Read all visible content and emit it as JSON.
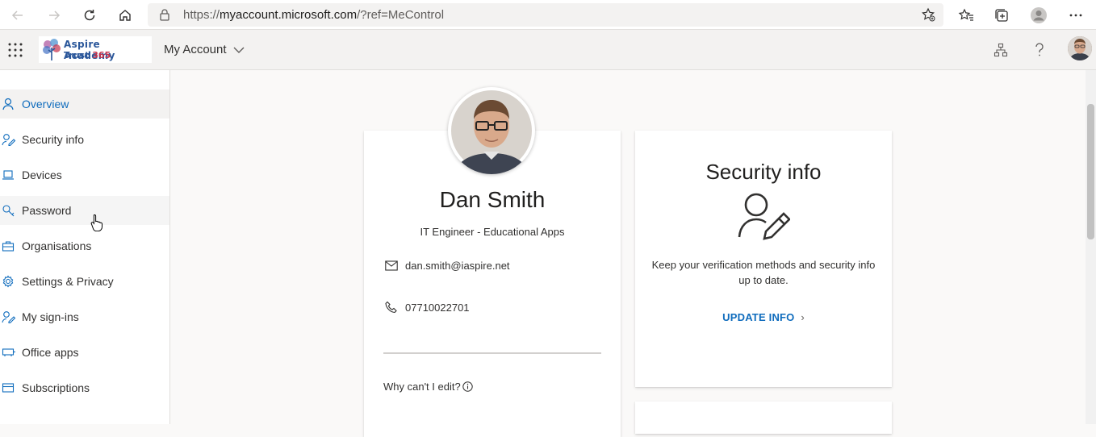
{
  "browser": {
    "url_prefix": "https://",
    "url_host": "myaccount.microsoft.com",
    "url_path": "/?ref=MeControl"
  },
  "header": {
    "org_line1": "Aspire Academy",
    "org_line2_word": "Trust",
    "org_line2_num": "365",
    "app_title": "My Account"
  },
  "sidebar": {
    "items": [
      {
        "label": "Overview",
        "icon": "person-icon"
      },
      {
        "label": "Security info",
        "icon": "person-key-icon"
      },
      {
        "label": "Devices",
        "icon": "laptop-icon"
      },
      {
        "label": "Password",
        "icon": "key-icon"
      },
      {
        "label": "Organisations",
        "icon": "briefcase-icon"
      },
      {
        "label": "Settings & Privacy",
        "icon": "gear-icon"
      },
      {
        "label": "My sign-ins",
        "icon": "person-key-icon"
      },
      {
        "label": "Office apps",
        "icon": "apps-icon"
      },
      {
        "label": "Subscriptions",
        "icon": "card-icon"
      }
    ]
  },
  "profile": {
    "name": "Dan Smith",
    "job_title": "IT Engineer - Educational Apps",
    "email": "dan.smith@iaspire.net",
    "phone": "07710022701",
    "why_edit": "Why can't I edit?"
  },
  "security": {
    "title": "Security info",
    "description": "Keep your verification methods and security info up to date.",
    "link": "UPDATE INFO",
    "link_chevron": "›"
  },
  "colors": {
    "accent": "#0f6cbd",
    "header_bg": "#f3f2f1",
    "page_bg": "#faf9f8"
  }
}
